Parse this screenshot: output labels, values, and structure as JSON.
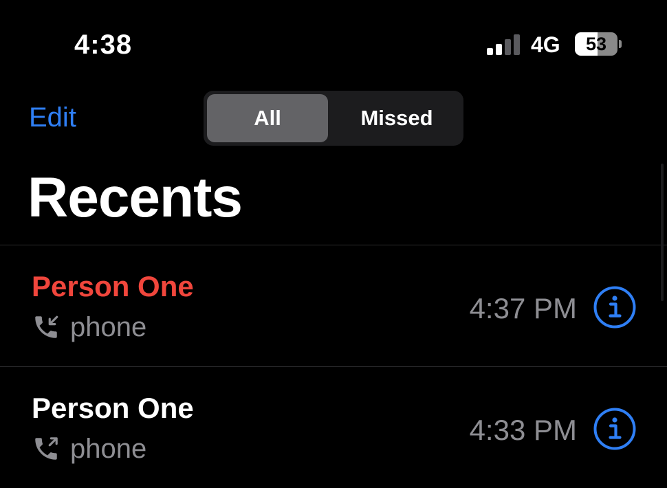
{
  "status_bar": {
    "time": "4:38",
    "network": "4G",
    "battery_percent": "53",
    "battery_level": 0.53,
    "signal_bars_active": 2,
    "signal_bars_total": 4
  },
  "header": {
    "edit_label": "Edit",
    "segments": [
      {
        "label": "All",
        "selected": true
      },
      {
        "label": "Missed",
        "selected": false
      }
    ],
    "title": "Recents"
  },
  "calls": [
    {
      "name": "Person One",
      "missed": true,
      "direction_icon": "incoming-call-icon",
      "type_label": "phone",
      "time": "4:37 PM"
    },
    {
      "name": "Person One",
      "missed": false,
      "direction_icon": "outgoing-call-icon",
      "type_label": "phone",
      "time": "4:33 PM"
    }
  ],
  "colors": {
    "background": "#000000",
    "accent_blue": "#2f7ff5",
    "missed_red": "#f0463c",
    "secondary_gray": "#8e8e93"
  }
}
